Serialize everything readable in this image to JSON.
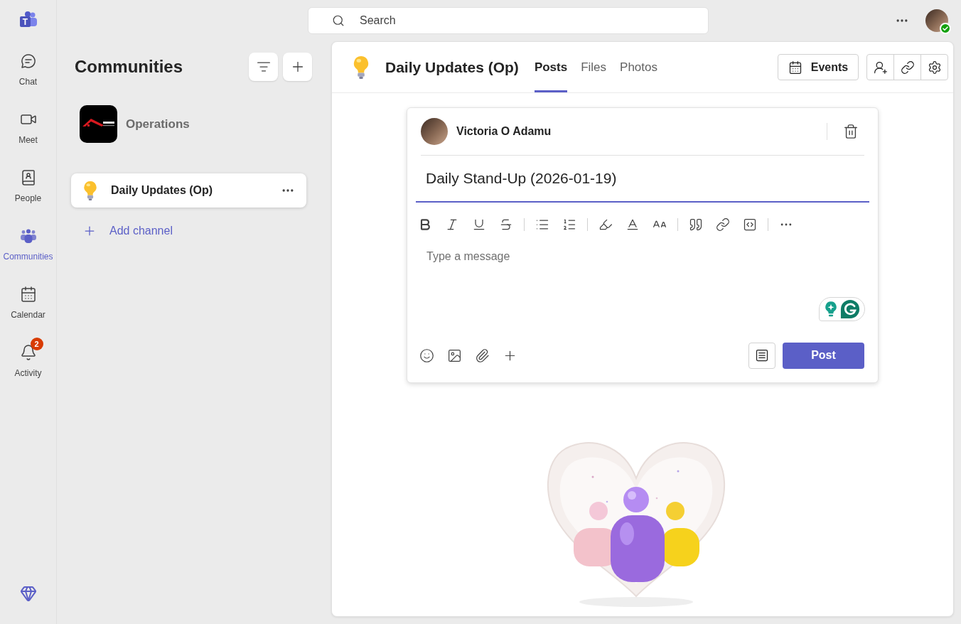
{
  "app_rail": {
    "logo_text": "T",
    "items": [
      {
        "label": "Chat",
        "selected": false
      },
      {
        "label": "Meet",
        "selected": false
      },
      {
        "label": "People",
        "selected": false
      },
      {
        "label": "Communities",
        "selected": true
      },
      {
        "label": "Calendar",
        "selected": false
      },
      {
        "label": "Activity",
        "selected": false,
        "badge": "2"
      }
    ]
  },
  "search": {
    "placeholder": "Search"
  },
  "account": {
    "available": true
  },
  "sidebar": {
    "title": "Communities",
    "community": {
      "name": "Operations"
    },
    "channels": [
      {
        "name": "Daily Updates (Op)",
        "selected": true
      }
    ],
    "add_channel": "Add channel"
  },
  "channel_header": {
    "title": "Daily Updates (Op)",
    "tabs": [
      {
        "label": "Posts",
        "selected": true
      },
      {
        "label": "Files",
        "selected": false
      },
      {
        "label": "Photos",
        "selected": false
      }
    ],
    "events_button": "Events"
  },
  "composer": {
    "author": "Victoria O Adamu",
    "subject": "Daily Stand-Up (2026-01-19)",
    "message_placeholder": "Type a message",
    "post_button": "Post"
  }
}
